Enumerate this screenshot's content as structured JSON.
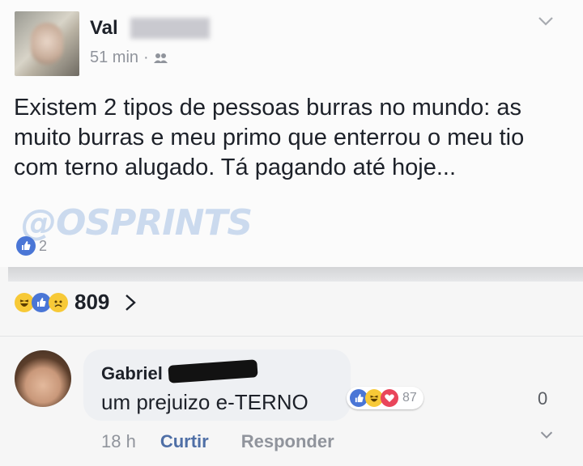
{
  "post": {
    "author_name": "Val",
    "time": "51 min",
    "separator": "·",
    "audience_icon": "friends-icon",
    "text": "Existem 2 tipos de pessoas burras no mundo: as muito burras e meu primo que enterrou o meu tio com terno alugado. Tá pagando até hoje...",
    "watermark": "@OSPRINTS",
    "inner_like_count": "2"
  },
  "reactions": {
    "icons": [
      "haha-icon",
      "like-icon",
      "sad-icon"
    ],
    "count": "809"
  },
  "comment": {
    "author_name": "Gabriel",
    "text": "um prejuizo e-TERNO",
    "reaction_icons": [
      "like-icon",
      "haha-icon",
      "love-icon"
    ],
    "reaction_count": "87",
    "reply_count": "0",
    "time": "18 h",
    "like_label": "Curtir",
    "reply_label": "Responder"
  },
  "colors": {
    "like_blue": "#4a76d6",
    "haha_yellow": "#f7c937",
    "love_red": "#e9455a",
    "link_blue": "#4f6fa6",
    "meta_gray": "#90949c"
  }
}
